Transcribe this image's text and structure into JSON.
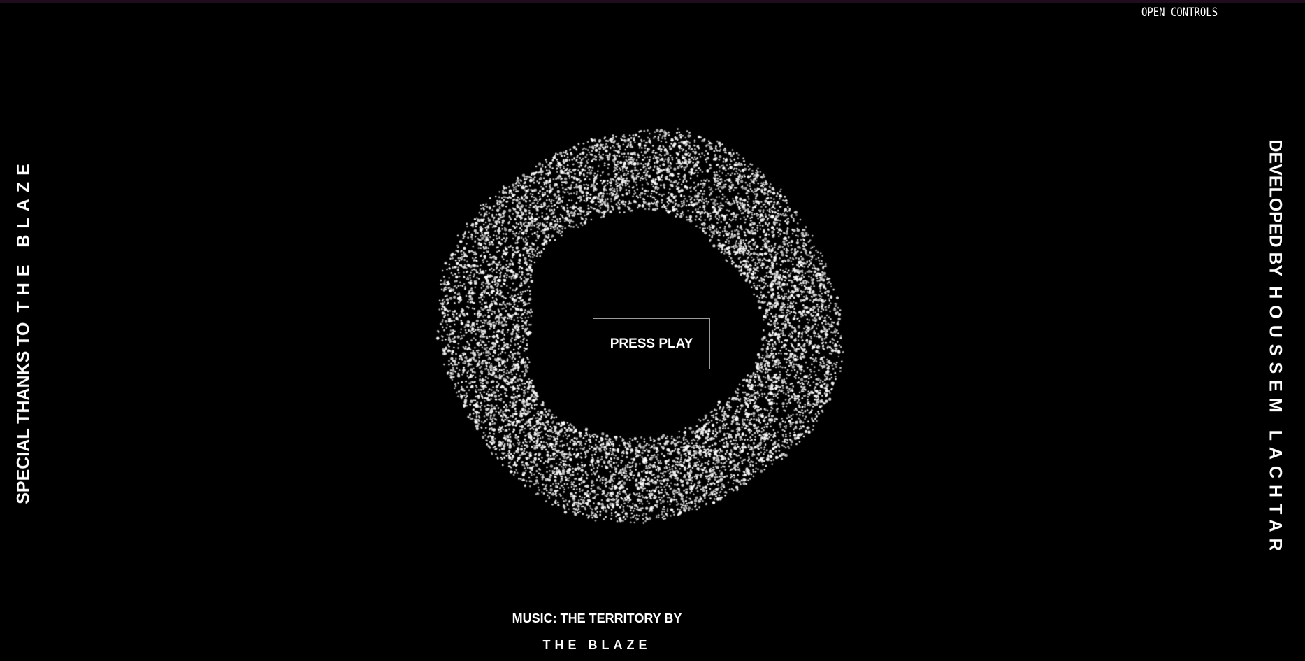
{
  "controls": {
    "open_label": "OPEN CONTROLS"
  },
  "player": {
    "play_label": "PRESS PLAY"
  },
  "credits_left": {
    "prefix": "SPECIAL THANKS TO",
    "name": "THE BLAZE"
  },
  "credits_right": {
    "prefix": "DEVELOPED BY",
    "name": "HOUSSEM LACHTAR"
  },
  "music": {
    "label": "MUSIC: THE TERRITORY BY",
    "artist": "THE BLAZE"
  },
  "colors": {
    "background": "#000000",
    "particles": "#ffffff",
    "top_bar": "#1f0d1e",
    "button_border": "#9a9a9a"
  }
}
